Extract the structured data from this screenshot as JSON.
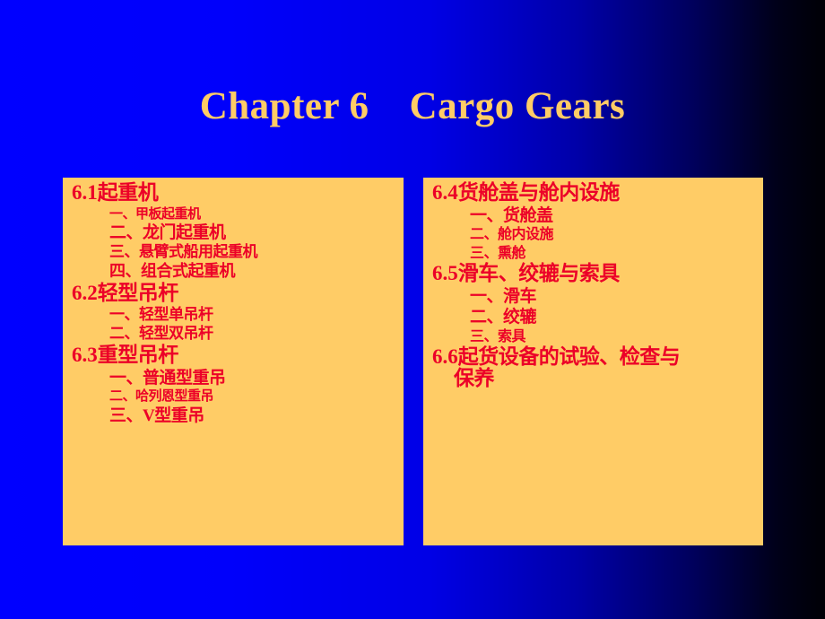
{
  "slide": {
    "title": "Chapter 6    Cargo Gears",
    "title_color": "#FFCC66",
    "background_from": "#0000FF",
    "background_to": "#000005",
    "box_fill": "#FFCC66",
    "text_color": "#EC0028"
  },
  "left_box": {
    "entries": [
      {
        "level": 1,
        "text": "6.1",
        "cjk": "起重机",
        "size": 23
      },
      {
        "level": 2,
        "text": "一、甲板起重机",
        "size": 15
      },
      {
        "level": 2,
        "text": "二、龙门起重机",
        "size": 19
      },
      {
        "level": 2,
        "text": "三、悬臂式船用起重机",
        "size": 17
      },
      {
        "level": 2,
        "text": "四、组合式起重机",
        "size": 18
      },
      {
        "level": 1,
        "text": "6.2",
        "cjk": "轻型吊杆",
        "size": 23
      },
      {
        "level": 2,
        "text": "一、轻型单吊杆",
        "size": 17
      },
      {
        "level": 2,
        "text": "二、轻型双吊杆",
        "size": 17
      },
      {
        "level": 1,
        "text": "6.3",
        "cjk": "重型吊杆",
        "size": 23
      },
      {
        "level": 2,
        "text": "一、普通型重吊",
        "size": 19
      },
      {
        "level": 2,
        "text": "二、哈列恩型重吊",
        "size": 15
      },
      {
        "level": 2,
        "text": "三、",
        "serif": "V",
        "tail": "型重吊",
        "size": 19
      }
    ]
  },
  "right_box": {
    "entries": [
      {
        "level": 1,
        "text": "6.4",
        "cjk": "货舱盖与舱内设施",
        "size": 23
      },
      {
        "level": 2,
        "text": "一、货舱盖",
        "size": 19
      },
      {
        "level": 2,
        "text": "二、舱内设施",
        "size": 16
      },
      {
        "level": 2,
        "text": "三、熏舱",
        "size": 16
      },
      {
        "level": 1,
        "text": "6.5",
        "cjk": "滑车、绞辘与索具",
        "size": 23
      },
      {
        "level": 2,
        "text": "一、滑车",
        "size": 19
      },
      {
        "level": 2,
        "text": "二、绞辘",
        "size": 19
      },
      {
        "level": 2,
        "text": "三、索具",
        "size": 16
      },
      {
        "level": 1,
        "text": "6.6",
        "cjk": "起货设备的试验、检查与",
        "size": 23
      },
      {
        "level": 1,
        "wrap": true,
        "cjk": "保养",
        "size": 23
      }
    ]
  }
}
